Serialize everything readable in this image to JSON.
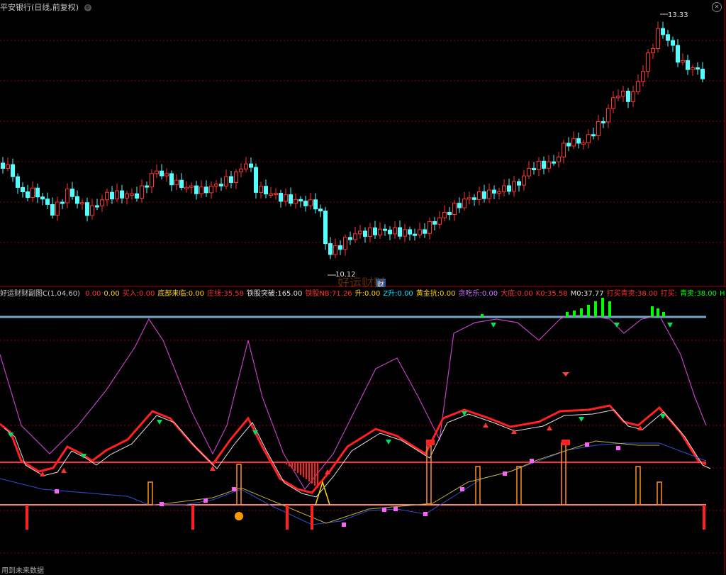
{
  "header": {
    "title": "平安银行(日线,前复权)",
    "icon": "gear-icon"
  },
  "price_labels": {
    "high": "13.33",
    "low": "10.12"
  },
  "fin_badge": "财",
  "watermark": "好运财财",
  "indicator": {
    "name": "好运财财副图C(1.04,60)",
    "items": [
      {
        "label": "",
        "value": "0.00",
        "color": "#ff3030"
      },
      {
        "label": "",
        "value": "0.00",
        "color": "#ffd700"
      },
      {
        "label": "买入:",
        "value": "0.00",
        "color": "#ff3030"
      },
      {
        "label": "底部来临:",
        "value": "0.00",
        "color": "#ffd700"
      },
      {
        "label": "庄线:",
        "value": "35.58",
        "color": "#ff3030"
      },
      {
        "label": "铁股突破:",
        "value": "165.00",
        "color": "#e0e0e0"
      },
      {
        "label": "铁股NB:",
        "value": "71.26",
        "color": "#ff3030"
      },
      {
        "label": "升:",
        "value": "0.00",
        "color": "#ffd700"
      },
      {
        "label": "Z升:",
        "value": "0.00",
        "color": "#00e0ff"
      },
      {
        "label": "黄金抗:",
        "value": "0.00",
        "color": "#ffd700"
      },
      {
        "label": "贪吃乐:",
        "value": "0.00",
        "color": "#d070ff"
      },
      {
        "label": "大底:",
        "value": "0.00",
        "color": "#ff3030"
      },
      {
        "label": "K0:",
        "value": "35.58",
        "color": "#ff3030"
      },
      {
        "label": "M0:",
        "value": "37.77",
        "color": "#e0e0e0"
      },
      {
        "label": "打买青卖:",
        "value": "38.00",
        "color": "#ff3030"
      },
      {
        "label": "打买:",
        "value": "",
        "color": "#ff3030"
      },
      {
        "label": "青卖:",
        "value": "38.00",
        "color": "#00ff00"
      },
      {
        "label": "H",
        "value": "",
        "color": "#00ff00"
      }
    ]
  },
  "footer": "用到未来数据",
  "colors": {
    "up": "#ff3232",
    "down": "#54ffff",
    "grid": "#8b0000"
  }
}
